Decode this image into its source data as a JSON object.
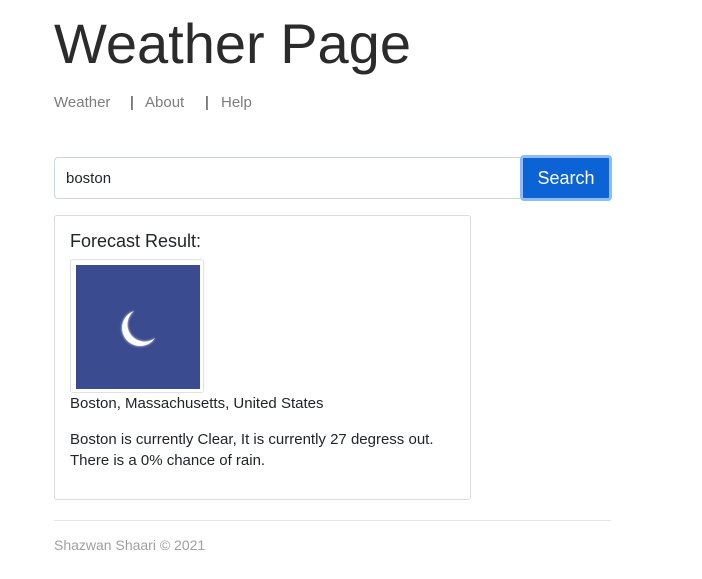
{
  "header": {
    "title": "Weather Page"
  },
  "nav": {
    "items": [
      {
        "label": "Weather"
      },
      {
        "label": "About"
      },
      {
        "label": "Help"
      }
    ],
    "separator": "|"
  },
  "search": {
    "value": "boston",
    "button_label": "Search"
  },
  "result": {
    "title": "Forecast Result:",
    "icon": "moon-icon",
    "location": "Boston, Massachusetts, United States",
    "forecast_line1": "Boston is currently Clear, It is currently 27 degress out.",
    "forecast_line2": "There is a 0% chance of rain."
  },
  "footer": {
    "text": "Shazwan Shaari © 2021"
  },
  "colors": {
    "accent": "#0b63d6",
    "icon_background": "#3b4b8f"
  }
}
